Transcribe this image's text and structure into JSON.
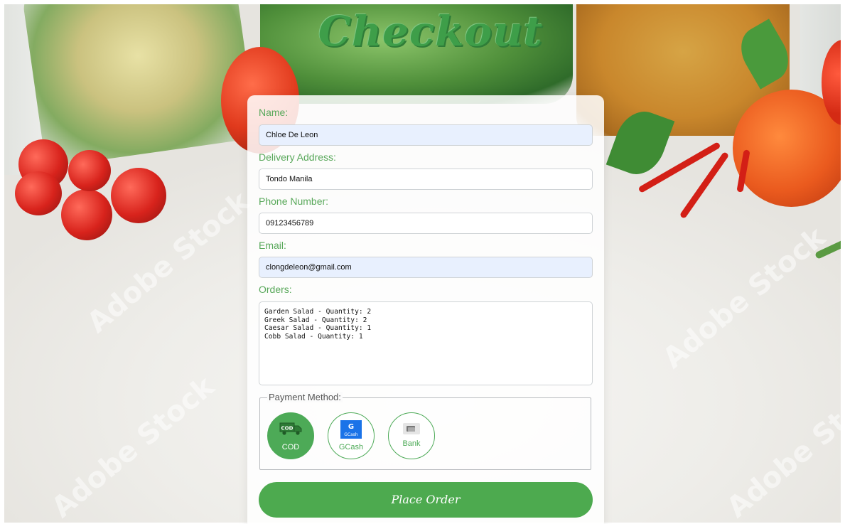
{
  "page": {
    "title": "Checkout"
  },
  "form": {
    "name_label": "Name:",
    "name_value": "Chloe De Leon",
    "address_label": "Delivery Address:",
    "address_value": "Tondo Manila",
    "phone_label": "Phone Number:",
    "phone_value": "09123456789",
    "email_label": "Email:",
    "email_value": "clongdeleon@gmail.com",
    "orders_label": "Orders:",
    "orders": [
      "Garden Salad - Quantity: 2",
      "Greek Salad - Quantity: 2",
      "Caesar Salad - Quantity: 1",
      "Cobb Salad - Quantity: 1"
    ]
  },
  "payment": {
    "legend": "Payment Method:",
    "options": [
      {
        "label": "COD",
        "icon": "delivery-truck-icon",
        "icon_text": "COD",
        "selected": true
      },
      {
        "label": "GCash",
        "icon": "gcash-logo-icon",
        "icon_text": "GCash",
        "selected": false
      },
      {
        "label": "Bank",
        "icon": "bank-card-icon",
        "selected": false
      }
    ]
  },
  "submit": {
    "label": "Place Order"
  },
  "colors": {
    "accent": "#4daa4f",
    "label": "#58a85a",
    "autofill": "#e8f0fe",
    "gcash_blue": "#1a73e8"
  },
  "watermark": "Adobe Stock"
}
